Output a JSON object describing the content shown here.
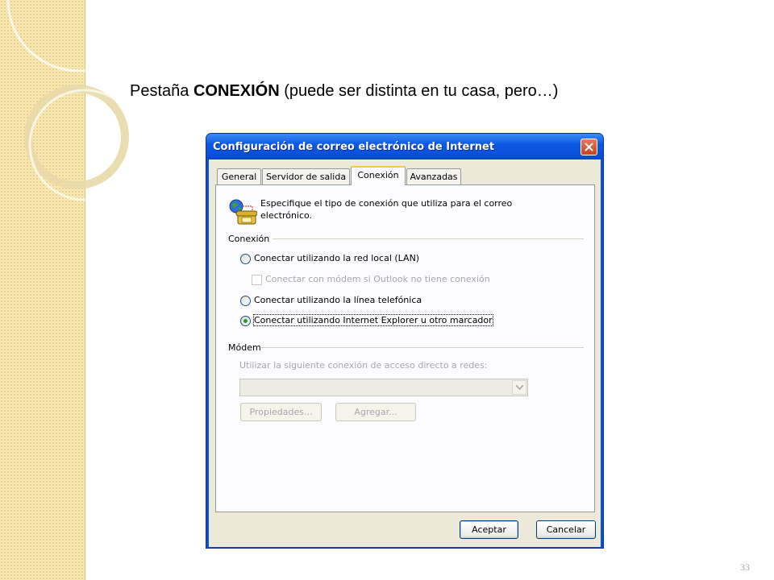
{
  "slide": {
    "title_prefix": "Pestaña ",
    "title_bold": "CONEXIÓN",
    "title_suffix": " (puede ser distinta en tu casa, pero…)",
    "page_number": "33"
  },
  "window": {
    "title": "Configuración de correo electrónico de Internet",
    "tabs": [
      {
        "label": "General",
        "active": false
      },
      {
        "label": "Servidor de salida",
        "active": false
      },
      {
        "label": "Conexión",
        "active": true
      },
      {
        "label": "Avanzadas",
        "active": false
      }
    ],
    "info_text": "Especifique el tipo de conexión que utiliza para el correo electrónico.",
    "connection_group": {
      "label": "Conexión",
      "options": [
        {
          "label": "Conectar utilizando la red local (LAN)",
          "checked": false
        },
        {
          "label": "Conectar utilizando la línea telefónica",
          "checked": false
        },
        {
          "label": "Conectar utilizando Internet Explorer u otro marcador",
          "checked": true
        }
      ],
      "modem_checkbox": {
        "label": "Conectar con módem si Outlook no tiene conexión",
        "checked": false,
        "enabled": false
      }
    },
    "modem_group": {
      "label": "Módem",
      "select_label": "Utilizar la siguiente conexión de acceso directo a redes:",
      "select_value": "",
      "properties_button": "Propiedades...",
      "add_button": "Agregar..."
    },
    "ok_button": "Aceptar",
    "cancel_button": "Cancelar"
  },
  "icons": {
    "close": "close-icon",
    "connection": "globe-phone-icon",
    "dropdown": "chevron-down-icon"
  },
  "colors": {
    "titlebar": "#0a52d4",
    "dialog_bg": "#ece9d8",
    "active_tab_accent": "#ffc83c",
    "radio_checked": "#21a121",
    "side_band": "#f7e7b0"
  }
}
